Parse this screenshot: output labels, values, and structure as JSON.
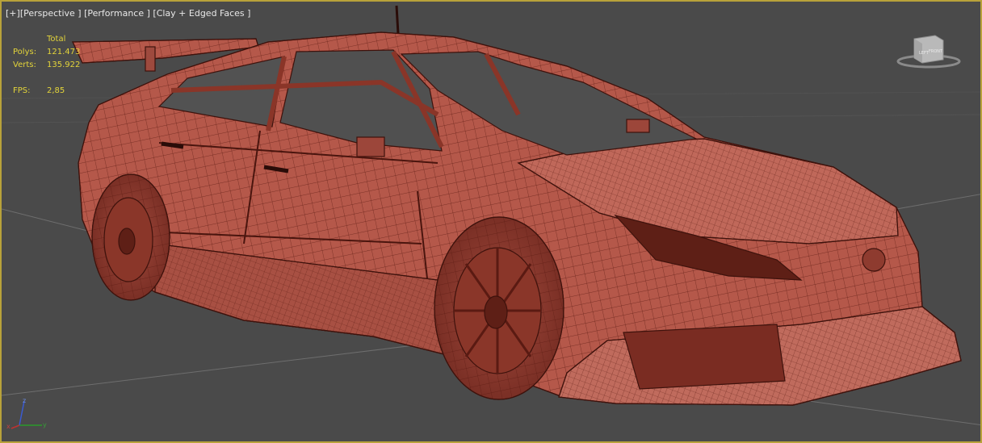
{
  "viewport": {
    "menu_plus": "[+]",
    "view_mode": "[Perspective ]",
    "performance": "[Performance ]",
    "shading": "[Clay + Edged Faces ]"
  },
  "stats": {
    "header": "Total",
    "polys_label": "Polys:",
    "polys_value": "121.473",
    "verts_label": "Verts:",
    "verts_value": "135.922",
    "fps_label": "FPS:",
    "fps_value": "2,85"
  },
  "viewcube": {
    "front": "FRONT",
    "side": "LEFT"
  },
  "axis": {
    "x": "x",
    "y": "y",
    "z": "z"
  },
  "colors": {
    "border": "#b8a23a",
    "clay": "#b5584a",
    "wire": "#5a1a12",
    "stats": "#e3d43a",
    "grid": "#6e6e6e"
  }
}
